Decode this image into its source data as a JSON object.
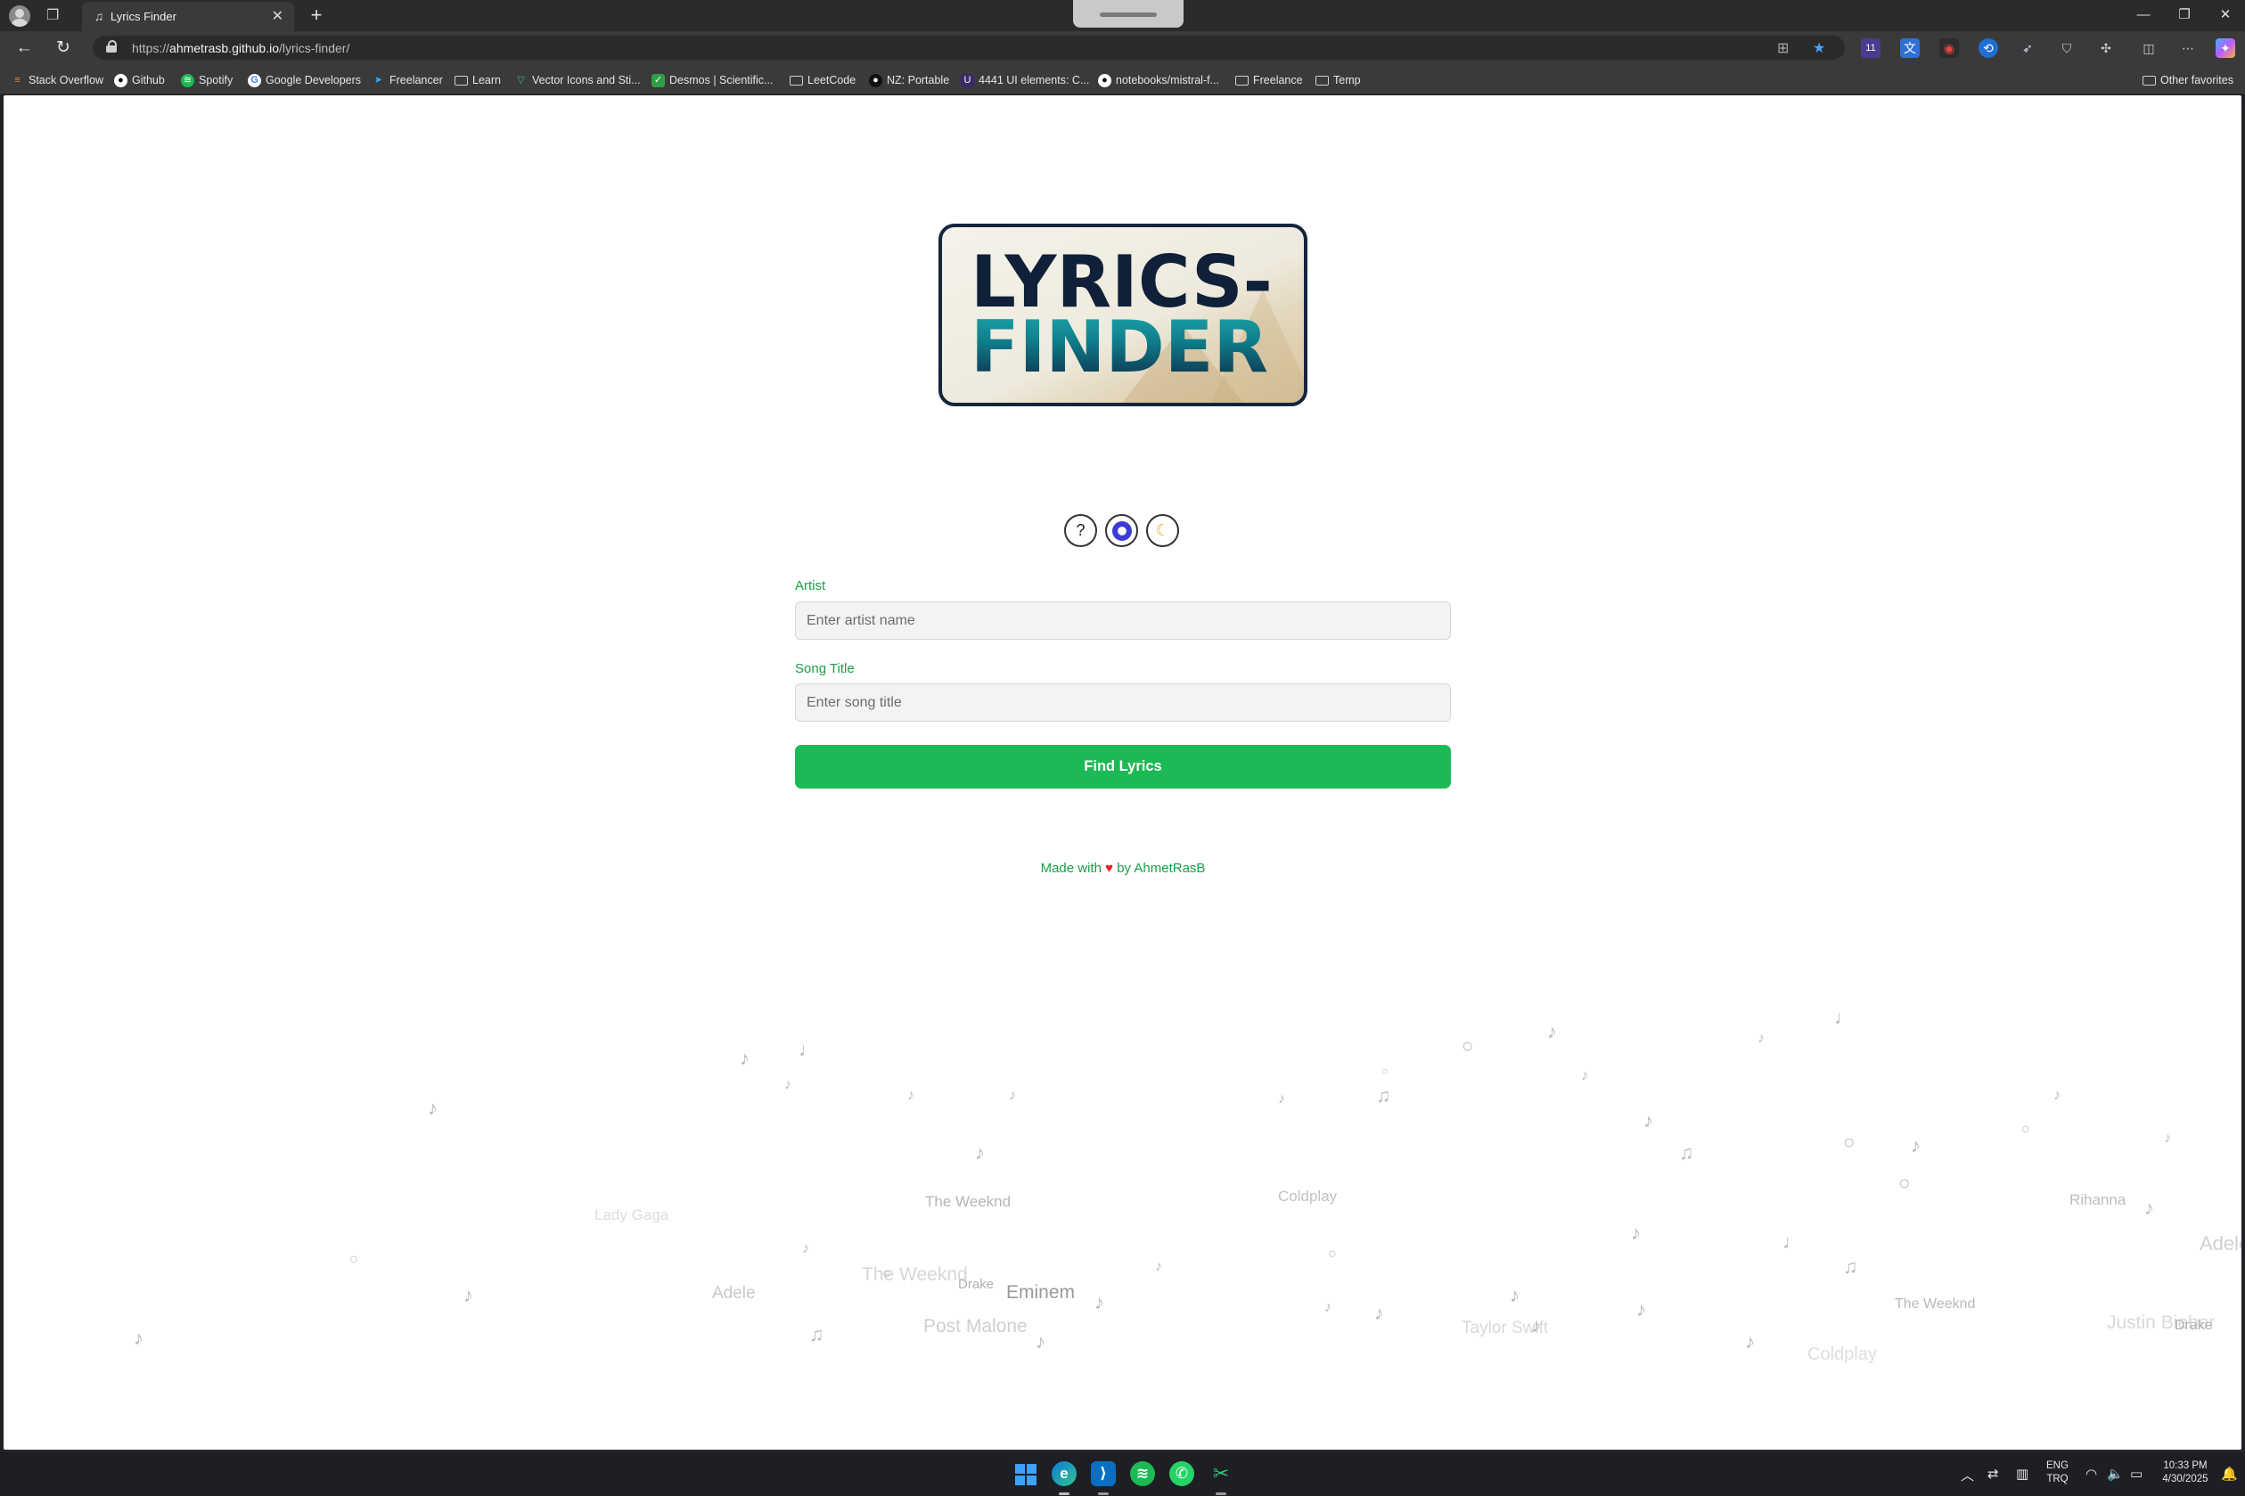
{
  "browser": {
    "tab_title": "Lyrics Finder",
    "url_prefix": "https://",
    "url_host": "ahmetrasb.github.io",
    "url_path": "/lyrics-finder/",
    "bookmarks": [
      {
        "label": "Stack Overflow",
        "icon": "stackoverflow-icon"
      },
      {
        "label": "Github",
        "icon": "github-icon"
      },
      {
        "label": "Spotify",
        "icon": "spotify-icon"
      },
      {
        "label": "Google Developers",
        "icon": "google-icon"
      },
      {
        "label": "Freelancer",
        "icon": "freelancer-icon"
      },
      {
        "label": "Learn",
        "icon": "folder-icon"
      },
      {
        "label": "Vector Icons and Sti...",
        "icon": "vector-icon"
      },
      {
        "label": "Desmos | Scientific...",
        "icon": "desmos-icon"
      },
      {
        "label": "LeetCode",
        "icon": "folder-icon"
      },
      {
        "label": "NZ: Portable",
        "icon": "nz-icon"
      },
      {
        "label": "4441 UI elements: C...",
        "icon": "ui-elements-icon"
      },
      {
        "label": "notebooks/mistral-f...",
        "icon": "github-icon"
      },
      {
        "label": "Freelance",
        "icon": "folder-icon"
      },
      {
        "label": "Temp",
        "icon": "folder-icon"
      }
    ],
    "other_favorites": "Other favorites",
    "extension_badge": "11"
  },
  "page": {
    "logo_line1": "LYRICS-",
    "logo_line2": "FINDER",
    "help_glyph": "?",
    "artist_label": "Artist",
    "artist_placeholder": "Enter artist name",
    "artist_value": "",
    "song_label": "Song Title",
    "song_placeholder": "Enter song title",
    "song_value": "",
    "find_button": "Find Lyrics",
    "footer_made": "Made with",
    "footer_heart": "♥",
    "footer_by": "by AhmetRasB",
    "background_artists": [
      "Lady Gaga",
      "The Weeknd",
      "Coldplay",
      "Rihanna",
      "Adele",
      "The Weeknd",
      "Drake",
      "Eminem",
      "Adele",
      "Post Malone",
      "Taylor Swift",
      "The Weeknd",
      "Justin Bieber",
      "Drake",
      "Coldplay"
    ]
  },
  "taskbar": {
    "lang_line1": "ENG",
    "lang_line2": "TRQ",
    "time": "10:33 PM",
    "date": "4/30/2025"
  },
  "colors": {
    "accent_green": "#1db954",
    "label_green": "#1a9e47",
    "logo_navy": "#0f2038",
    "logo_teal": "#1ea3a8"
  }
}
